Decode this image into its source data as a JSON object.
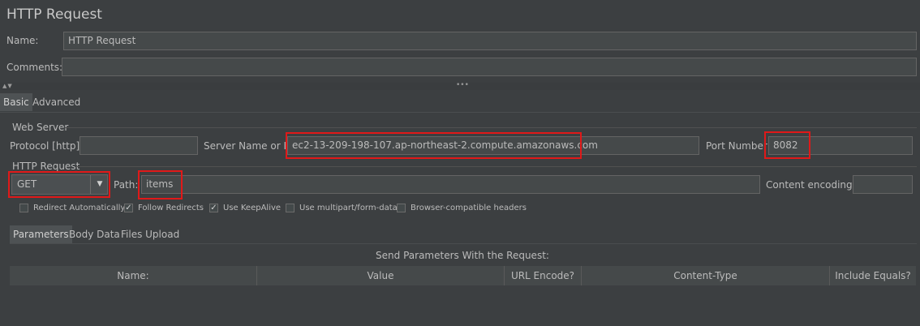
{
  "panel": {
    "title": "HTTP Request"
  },
  "name_field": {
    "label": "Name:",
    "value": "HTTP Request"
  },
  "comments_field": {
    "label": "Comments:",
    "value": ""
  },
  "splitter": {
    "arrows": "▲▼",
    "handle": "•••"
  },
  "tabs": {
    "basic": "Basic",
    "advanced": "Advanced"
  },
  "web_server": {
    "heading": "Web Server",
    "protocol_label": "Protocol [http]:",
    "protocol_value": "",
    "server_label": "Server Name or IP:",
    "server_value": "ec2-13-209-198-107.ap-northeast-2.compute.amazonaws.com",
    "port_label": "Port Number:",
    "port_value": "8082"
  },
  "http_request": {
    "heading": "HTTP Request",
    "method": "GET",
    "path_label": "Path:",
    "path_value": "items",
    "encoding_label": "Content encoding:",
    "encoding_value": ""
  },
  "options": {
    "redirect_auto": {
      "label": "Redirect Automatically",
      "mark": ""
    },
    "follow_redirects": {
      "label": "Follow Redirects",
      "mark": "✓"
    },
    "keepalive": {
      "label": "Use KeepAlive",
      "mark": "✓"
    },
    "multipart": {
      "label": "Use multipart/form-data",
      "mark": ""
    },
    "browser_headers": {
      "label": "Browser-compatible headers",
      "mark": ""
    }
  },
  "sub_tabs": {
    "parameters": "Parameters",
    "body": "Body Data",
    "files": "Files Upload"
  },
  "params_table": {
    "caption": "Send Parameters With the Request:",
    "columns": [
      "Name:",
      "Value",
      "URL Encode?",
      "Content-Type",
      "Include Equals?"
    ]
  },
  "colors": {
    "background": "#3c3f41",
    "field": "#45494a",
    "highlight": "#e01919"
  },
  "icons": {
    "dropdown": "triangle-down-icon"
  }
}
